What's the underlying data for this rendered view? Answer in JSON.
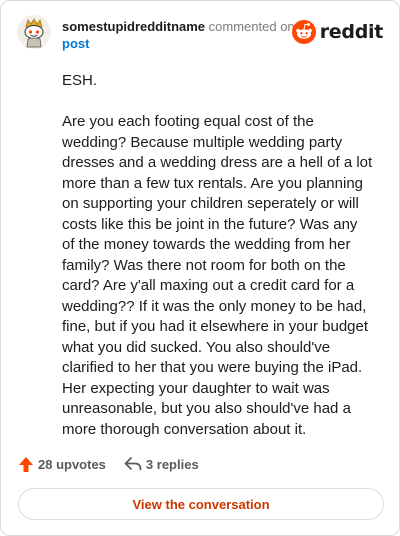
{
  "header": {
    "username": "somestupidredditname",
    "commented_text": "commented on",
    "post_link": "post",
    "brand_name": "reddit"
  },
  "comment": {
    "paragraphs": [
      "ESH.",
      "Are you each footing equal cost of the wedding? Because multiple wedding party dresses and a wedding dress are a hell of a lot more than a few tux rentals. Are you planning on supporting your children seperately or will costs like this be joint in the future? Was any of the money towards the wedding from her family? Was there not room for both on the card? Are y'all maxing out a credit card for a wedding?? If it was the only money to be had, fine, but if you had it elsewhere in your budget what you did sucked. You also should've clarified to her that you were buying the iPad. Her expecting your daughter to wait was unreasonable, but you also should've had a more thorough conversation about it."
    ]
  },
  "footer": {
    "upvotes": "28 upvotes",
    "replies": "3 replies",
    "view_button": "View the conversation"
  },
  "colors": {
    "accent": "#ff4500",
    "link": "#0079d3",
    "button_text": "#cc3700",
    "muted": "#7c7c7c"
  },
  "icons": {
    "avatar": "snoo-avatar-icon",
    "brand": "reddit-logo-icon",
    "upvote": "upvote-arrow-icon",
    "reply": "reply-arrow-icon"
  }
}
